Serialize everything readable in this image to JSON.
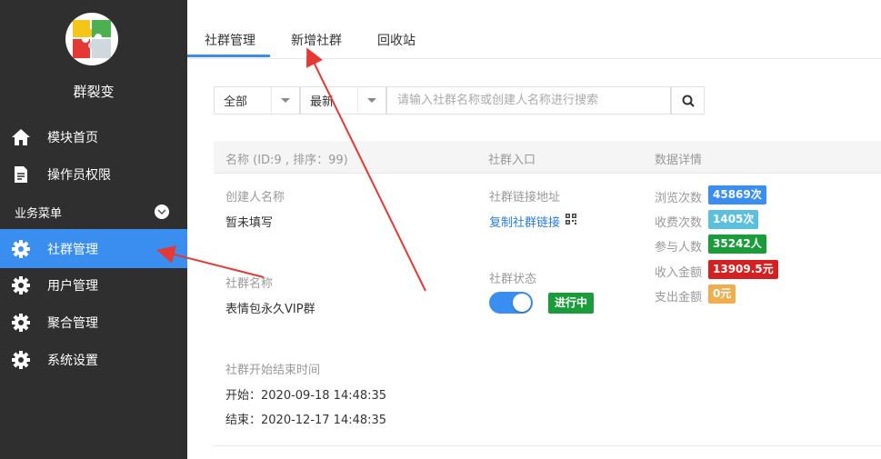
{
  "app": {
    "name": "群裂变"
  },
  "sidebar": {
    "items": [
      {
        "label": "模块首页",
        "icon": "home-icon"
      },
      {
        "label": "操作员权限",
        "icon": "document-edit-icon"
      }
    ],
    "section_label": "业务菜单",
    "menu": [
      {
        "label": "社群管理",
        "icon": "gear-icon",
        "active": true
      },
      {
        "label": "用户管理",
        "icon": "gear-icon"
      },
      {
        "label": "聚合管理",
        "icon": "gear-icon"
      },
      {
        "label": "系统设置",
        "icon": "gear-icon"
      }
    ]
  },
  "tabs": [
    {
      "label": "社群管理",
      "active": true
    },
    {
      "label": "新增社群"
    },
    {
      "label": "回收站"
    }
  ],
  "filters": {
    "scope": "全部",
    "sort": "最新",
    "search_placeholder": "请输入社群名称或创建人名称进行搜索"
  },
  "table": {
    "headers": {
      "name": "名称 (ID:9 , 排序：99)",
      "entry": "社群入口",
      "stats": "数据详情"
    }
  },
  "record": {
    "creator_label": "创建人名称",
    "creator_value": "暂未填写",
    "link_label": "社群链接地址",
    "link_text": "复制社群链接",
    "group_name_label": "社群名称",
    "group_name_value": "表情包永久VIP群",
    "status_label": "社群状态",
    "status_value": "进行中",
    "status_on": true,
    "period_label": "社群开始结束时间",
    "start": "开始：2020-09-18 14:48:35",
    "end": "结束：2020-12-17 14:48:35",
    "stats": [
      {
        "label": "浏览次数",
        "value": "45869次",
        "color": "#3a8ef0"
      },
      {
        "label": "收费次数",
        "value": "1405次",
        "color": "#5bc0de"
      },
      {
        "label": "参与人数",
        "value": "35242人",
        "color": "#1a9c3a"
      },
      {
        "label": "收入金额",
        "value": "13909.5元",
        "color": "#d32020"
      },
      {
        "label": "支出金额",
        "value": "0元",
        "color": "#f0ad4e"
      }
    ]
  },
  "colors": {
    "accent": "#3a8ef0",
    "sidebar_bg": "#2f2f2f",
    "annotation_arrow": "#e53935"
  }
}
